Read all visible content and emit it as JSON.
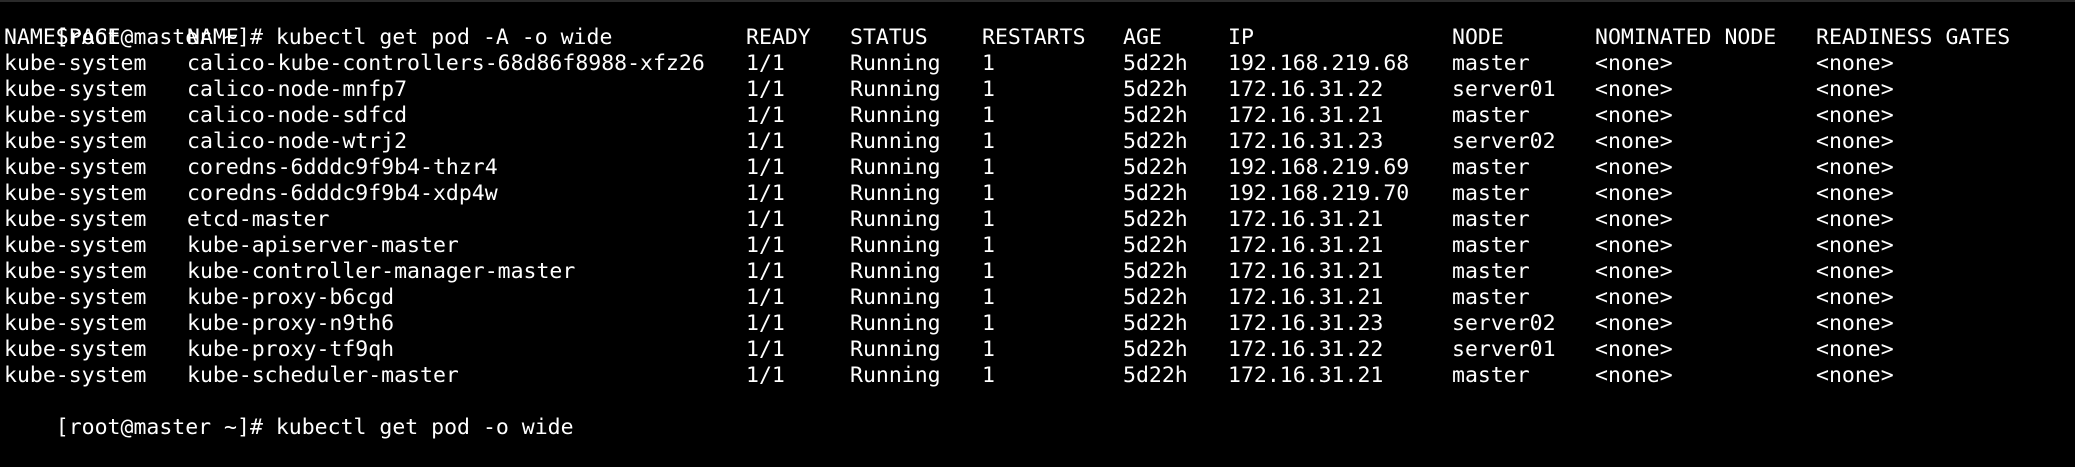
{
  "prompt_lines": [
    {
      "prompt": "[root@master ~]# ",
      "command": "kubectl get pod -A -o wide"
    },
    {
      "prompt": "[root@master ~]# ",
      "command": "kubectl get pod -o wide"
    }
  ],
  "table": {
    "headers": [
      "NAMESPACE",
      "NAME",
      "READY",
      "STATUS",
      "RESTARTS",
      "AGE",
      "IP",
      "NODE",
      "NOMINATED NODE",
      "READINESS GATES"
    ],
    "rows": [
      [
        "kube-system",
        "calico-kube-controllers-68d86f8988-xfz26",
        "1/1",
        "Running",
        "1",
        "5d22h",
        "192.168.219.68",
        "master",
        "<none>",
        "<none>"
      ],
      [
        "kube-system",
        "calico-node-mnfp7",
        "1/1",
        "Running",
        "1",
        "5d22h",
        "172.16.31.22",
        "server01",
        "<none>",
        "<none>"
      ],
      [
        "kube-system",
        "calico-node-sdfcd",
        "1/1",
        "Running",
        "1",
        "5d22h",
        "172.16.31.21",
        "master",
        "<none>",
        "<none>"
      ],
      [
        "kube-system",
        "calico-node-wtrj2",
        "1/1",
        "Running",
        "1",
        "5d22h",
        "172.16.31.23",
        "server02",
        "<none>",
        "<none>"
      ],
      [
        "kube-system",
        "coredns-6dddc9f9b4-thzr4",
        "1/1",
        "Running",
        "1",
        "5d22h",
        "192.168.219.69",
        "master",
        "<none>",
        "<none>"
      ],
      [
        "kube-system",
        "coredns-6dddc9f9b4-xdp4w",
        "1/1",
        "Running",
        "1",
        "5d22h",
        "192.168.219.70",
        "master",
        "<none>",
        "<none>"
      ],
      [
        "kube-system",
        "etcd-master",
        "1/1",
        "Running",
        "1",
        "5d22h",
        "172.16.31.21",
        "master",
        "<none>",
        "<none>"
      ],
      [
        "kube-system",
        "kube-apiserver-master",
        "1/1",
        "Running",
        "1",
        "5d22h",
        "172.16.31.21",
        "master",
        "<none>",
        "<none>"
      ],
      [
        "kube-system",
        "kube-controller-manager-master",
        "1/1",
        "Running",
        "1",
        "5d22h",
        "172.16.31.21",
        "master",
        "<none>",
        "<none>"
      ],
      [
        "kube-system",
        "kube-proxy-b6cgd",
        "1/1",
        "Running",
        "1",
        "5d22h",
        "172.16.31.21",
        "master",
        "<none>",
        "<none>"
      ],
      [
        "kube-system",
        "kube-proxy-n9th6",
        "1/1",
        "Running",
        "1",
        "5d22h",
        "172.16.31.23",
        "server02",
        "<none>",
        "<none>"
      ],
      [
        "kube-system",
        "kube-proxy-tf9qh",
        "1/1",
        "Running",
        "1",
        "5d22h",
        "172.16.31.22",
        "server01",
        "<none>",
        "<none>"
      ],
      [
        "kube-system",
        "kube-scheduler-master",
        "1/1",
        "Running",
        "1",
        "5d22h",
        "172.16.31.21",
        "master",
        "<none>",
        "<none>"
      ]
    ]
  },
  "colors": {
    "background": "#000000",
    "foreground": "#ffffff"
  }
}
